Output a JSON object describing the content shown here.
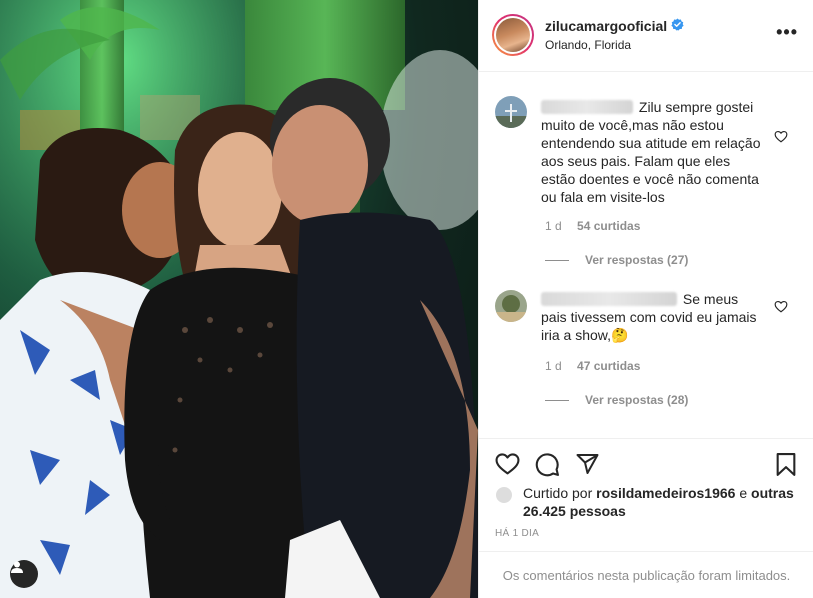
{
  "post": {
    "username": "zilucamargooficial",
    "location": "Orlando, Florida",
    "more_icon": "more-horizontal-icon",
    "verified_icon": "verified-badge-icon"
  },
  "comments": [
    {
      "text": "Zilu sempre gostei muito de você,mas não estou entendendo sua atitude em relação aos seus pais. Falam que eles estão doentes e você não comenta ou fala em visite-los",
      "time": "1 d",
      "likes": "54 curtidas",
      "replies": "Ver respostas (27)"
    },
    {
      "text": "Se meus pais tivessem com covid eu jamais iria a show,🤔",
      "time": "1 d",
      "likes": "47 curtidas",
      "replies": "Ver respostas (28)"
    }
  ],
  "liked_by": {
    "prefix": "Curtido por",
    "user": "rosildamedeiros1966",
    "connector": "e",
    "others": "outras 26.425 pessoas"
  },
  "time_ago": "HÁ 1 DIA",
  "comments_limited": "Os comentários nesta publicação foram limitados.",
  "colors": {
    "text": "#262626",
    "secondary": "#8e8e8e",
    "verified": "#3897f0",
    "border": "#efefef"
  }
}
